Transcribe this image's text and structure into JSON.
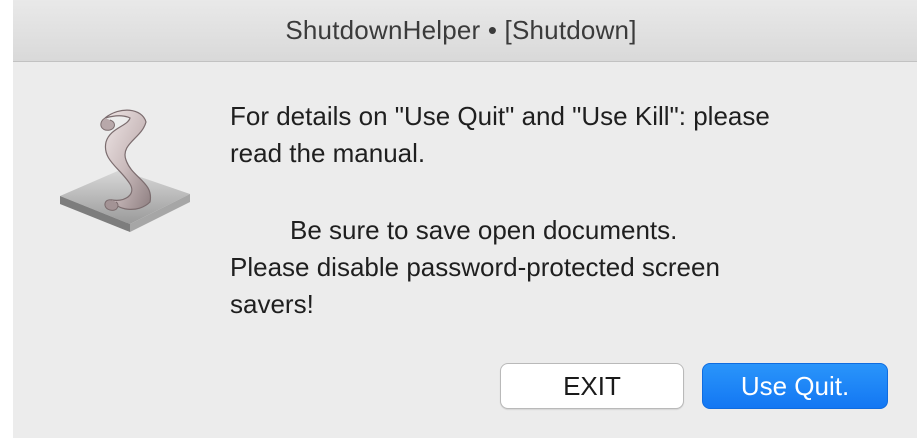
{
  "window": {
    "title": "ShutdownHelper • [Shutdown]"
  },
  "icon": {
    "name": "script-scroll-icon"
  },
  "message": {
    "line1": "For details on \"Use Quit\" and \"Use Kill\": please",
    "line2": "read the manual.",
    "line3": "Be sure to save open documents.",
    "line4": "Please disable password-protected screen",
    "line5": "savers!"
  },
  "buttons": {
    "exit_label": "EXIT",
    "quit_label": "Use Quit."
  },
  "colors": {
    "background": "#ececec",
    "accent": "#1a84f7"
  }
}
